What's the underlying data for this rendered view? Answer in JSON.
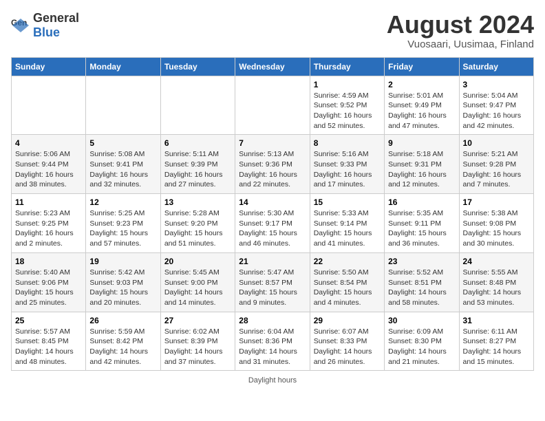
{
  "header": {
    "logo_general": "General",
    "logo_blue": "Blue",
    "title": "August 2024",
    "subtitle": "Vuosaari, Uusimaa, Finland"
  },
  "weekdays": [
    "Sunday",
    "Monday",
    "Tuesday",
    "Wednesday",
    "Thursday",
    "Friday",
    "Saturday"
  ],
  "weeks": [
    [
      {
        "day": "",
        "info": ""
      },
      {
        "day": "",
        "info": ""
      },
      {
        "day": "",
        "info": ""
      },
      {
        "day": "",
        "info": ""
      },
      {
        "day": "1",
        "info": "Sunrise: 4:59 AM\nSunset: 9:52 PM\nDaylight: 16 hours\nand 52 minutes."
      },
      {
        "day": "2",
        "info": "Sunrise: 5:01 AM\nSunset: 9:49 PM\nDaylight: 16 hours\nand 47 minutes."
      },
      {
        "day": "3",
        "info": "Sunrise: 5:04 AM\nSunset: 9:47 PM\nDaylight: 16 hours\nand 42 minutes."
      }
    ],
    [
      {
        "day": "4",
        "info": "Sunrise: 5:06 AM\nSunset: 9:44 PM\nDaylight: 16 hours\nand 38 minutes."
      },
      {
        "day": "5",
        "info": "Sunrise: 5:08 AM\nSunset: 9:41 PM\nDaylight: 16 hours\nand 32 minutes."
      },
      {
        "day": "6",
        "info": "Sunrise: 5:11 AM\nSunset: 9:39 PM\nDaylight: 16 hours\nand 27 minutes."
      },
      {
        "day": "7",
        "info": "Sunrise: 5:13 AM\nSunset: 9:36 PM\nDaylight: 16 hours\nand 22 minutes."
      },
      {
        "day": "8",
        "info": "Sunrise: 5:16 AM\nSunset: 9:33 PM\nDaylight: 16 hours\nand 17 minutes."
      },
      {
        "day": "9",
        "info": "Sunrise: 5:18 AM\nSunset: 9:31 PM\nDaylight: 16 hours\nand 12 minutes."
      },
      {
        "day": "10",
        "info": "Sunrise: 5:21 AM\nSunset: 9:28 PM\nDaylight: 16 hours\nand 7 minutes."
      }
    ],
    [
      {
        "day": "11",
        "info": "Sunrise: 5:23 AM\nSunset: 9:25 PM\nDaylight: 16 hours\nand 2 minutes."
      },
      {
        "day": "12",
        "info": "Sunrise: 5:25 AM\nSunset: 9:23 PM\nDaylight: 15 hours\nand 57 minutes."
      },
      {
        "day": "13",
        "info": "Sunrise: 5:28 AM\nSunset: 9:20 PM\nDaylight: 15 hours\nand 51 minutes."
      },
      {
        "day": "14",
        "info": "Sunrise: 5:30 AM\nSunset: 9:17 PM\nDaylight: 15 hours\nand 46 minutes."
      },
      {
        "day": "15",
        "info": "Sunrise: 5:33 AM\nSunset: 9:14 PM\nDaylight: 15 hours\nand 41 minutes."
      },
      {
        "day": "16",
        "info": "Sunrise: 5:35 AM\nSunset: 9:11 PM\nDaylight: 15 hours\nand 36 minutes."
      },
      {
        "day": "17",
        "info": "Sunrise: 5:38 AM\nSunset: 9:08 PM\nDaylight: 15 hours\nand 30 minutes."
      }
    ],
    [
      {
        "day": "18",
        "info": "Sunrise: 5:40 AM\nSunset: 9:06 PM\nDaylight: 15 hours\nand 25 minutes."
      },
      {
        "day": "19",
        "info": "Sunrise: 5:42 AM\nSunset: 9:03 PM\nDaylight: 15 hours\nand 20 minutes."
      },
      {
        "day": "20",
        "info": "Sunrise: 5:45 AM\nSunset: 9:00 PM\nDaylight: 14 hours\nand 14 minutes."
      },
      {
        "day": "21",
        "info": "Sunrise: 5:47 AM\nSunset: 8:57 PM\nDaylight: 15 hours\nand 9 minutes."
      },
      {
        "day": "22",
        "info": "Sunrise: 5:50 AM\nSunset: 8:54 PM\nDaylight: 15 hours\nand 4 minutes."
      },
      {
        "day": "23",
        "info": "Sunrise: 5:52 AM\nSunset: 8:51 PM\nDaylight: 14 hours\nand 58 minutes."
      },
      {
        "day": "24",
        "info": "Sunrise: 5:55 AM\nSunset: 8:48 PM\nDaylight: 14 hours\nand 53 minutes."
      }
    ],
    [
      {
        "day": "25",
        "info": "Sunrise: 5:57 AM\nSunset: 8:45 PM\nDaylight: 14 hours\nand 48 minutes."
      },
      {
        "day": "26",
        "info": "Sunrise: 5:59 AM\nSunset: 8:42 PM\nDaylight: 14 hours\nand 42 minutes."
      },
      {
        "day": "27",
        "info": "Sunrise: 6:02 AM\nSunset: 8:39 PM\nDaylight: 14 hours\nand 37 minutes."
      },
      {
        "day": "28",
        "info": "Sunrise: 6:04 AM\nSunset: 8:36 PM\nDaylight: 14 hours\nand 31 minutes."
      },
      {
        "day": "29",
        "info": "Sunrise: 6:07 AM\nSunset: 8:33 PM\nDaylight: 14 hours\nand 26 minutes."
      },
      {
        "day": "30",
        "info": "Sunrise: 6:09 AM\nSunset: 8:30 PM\nDaylight: 14 hours\nand 21 minutes."
      },
      {
        "day": "31",
        "info": "Sunrise: 6:11 AM\nSunset: 8:27 PM\nDaylight: 14 hours\nand 15 minutes."
      }
    ]
  ],
  "legend": {
    "daylight_label": "Daylight hours"
  }
}
